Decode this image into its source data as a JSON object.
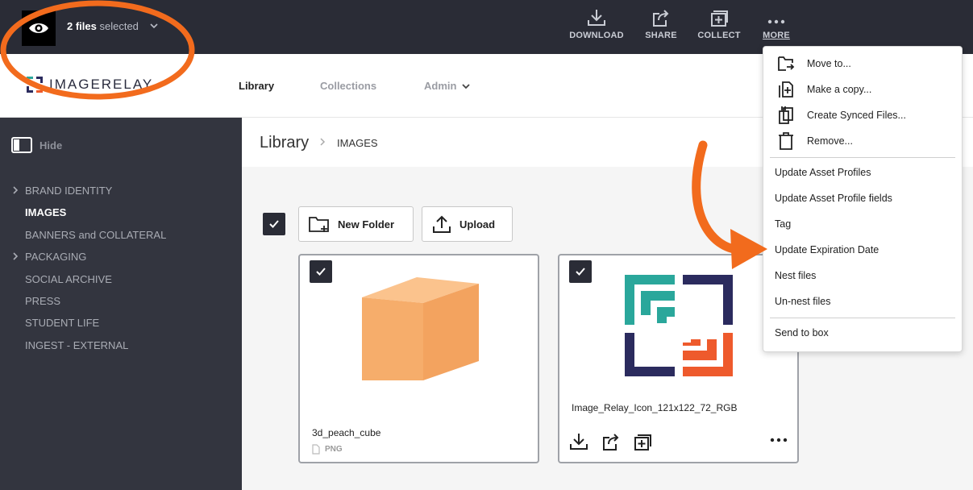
{
  "selection": {
    "count_label": "2 files",
    "suffix": "selected"
  },
  "top_actions": {
    "download": "DOWNLOAD",
    "share": "SHARE",
    "collect": "COLLECT",
    "more": "MORE"
  },
  "logo": {
    "text": "IMAGERELAY"
  },
  "nav": {
    "library": "Library",
    "collections": "Collections",
    "admin": "Admin"
  },
  "sidebar": {
    "hide_label": "Hide",
    "items": [
      {
        "label": "BRAND IDENTITY",
        "has_children": true,
        "current": false
      },
      {
        "label": "IMAGES",
        "has_children": false,
        "current": true
      },
      {
        "label": "BANNERS and COLLATERAL",
        "has_children": false,
        "current": false
      },
      {
        "label": "PACKAGING",
        "has_children": true,
        "current": false
      },
      {
        "label": "SOCIAL ARCHIVE",
        "has_children": false,
        "current": false
      },
      {
        "label": "PRESS",
        "has_children": false,
        "current": false
      },
      {
        "label": "STUDENT LIFE",
        "has_children": false,
        "current": false
      },
      {
        "label": "INGEST - EXTERNAL",
        "has_children": false,
        "current": false
      }
    ]
  },
  "breadcrumb": {
    "root": "Library",
    "current": "IMAGES"
  },
  "toolbar": {
    "new_folder": "New Folder",
    "upload": "Upload"
  },
  "files": [
    {
      "name": "3d_peach_cube",
      "type": "PNG",
      "selected": true
    },
    {
      "name": "Image_Relay_Icon_121x122_72_RGB",
      "type": "",
      "selected": true
    }
  ],
  "more_menu": {
    "items": [
      "Move to...",
      "Make a copy...",
      "Create Synced Files...",
      "Remove...",
      "Update Asset Profiles",
      "Update Asset Profile fields",
      "Tag",
      "Update Expiration Date",
      "Nest files",
      "Un-nest files",
      "Send to box"
    ]
  },
  "colors": {
    "topbar": "#2a2c36",
    "sidebar": "#33353f",
    "annotation": "#f26b1d",
    "teal": "#2aa79b",
    "navy": "#2b2b5e",
    "orange_red": "#ee5a2c",
    "peach": "#f6ad6b"
  }
}
